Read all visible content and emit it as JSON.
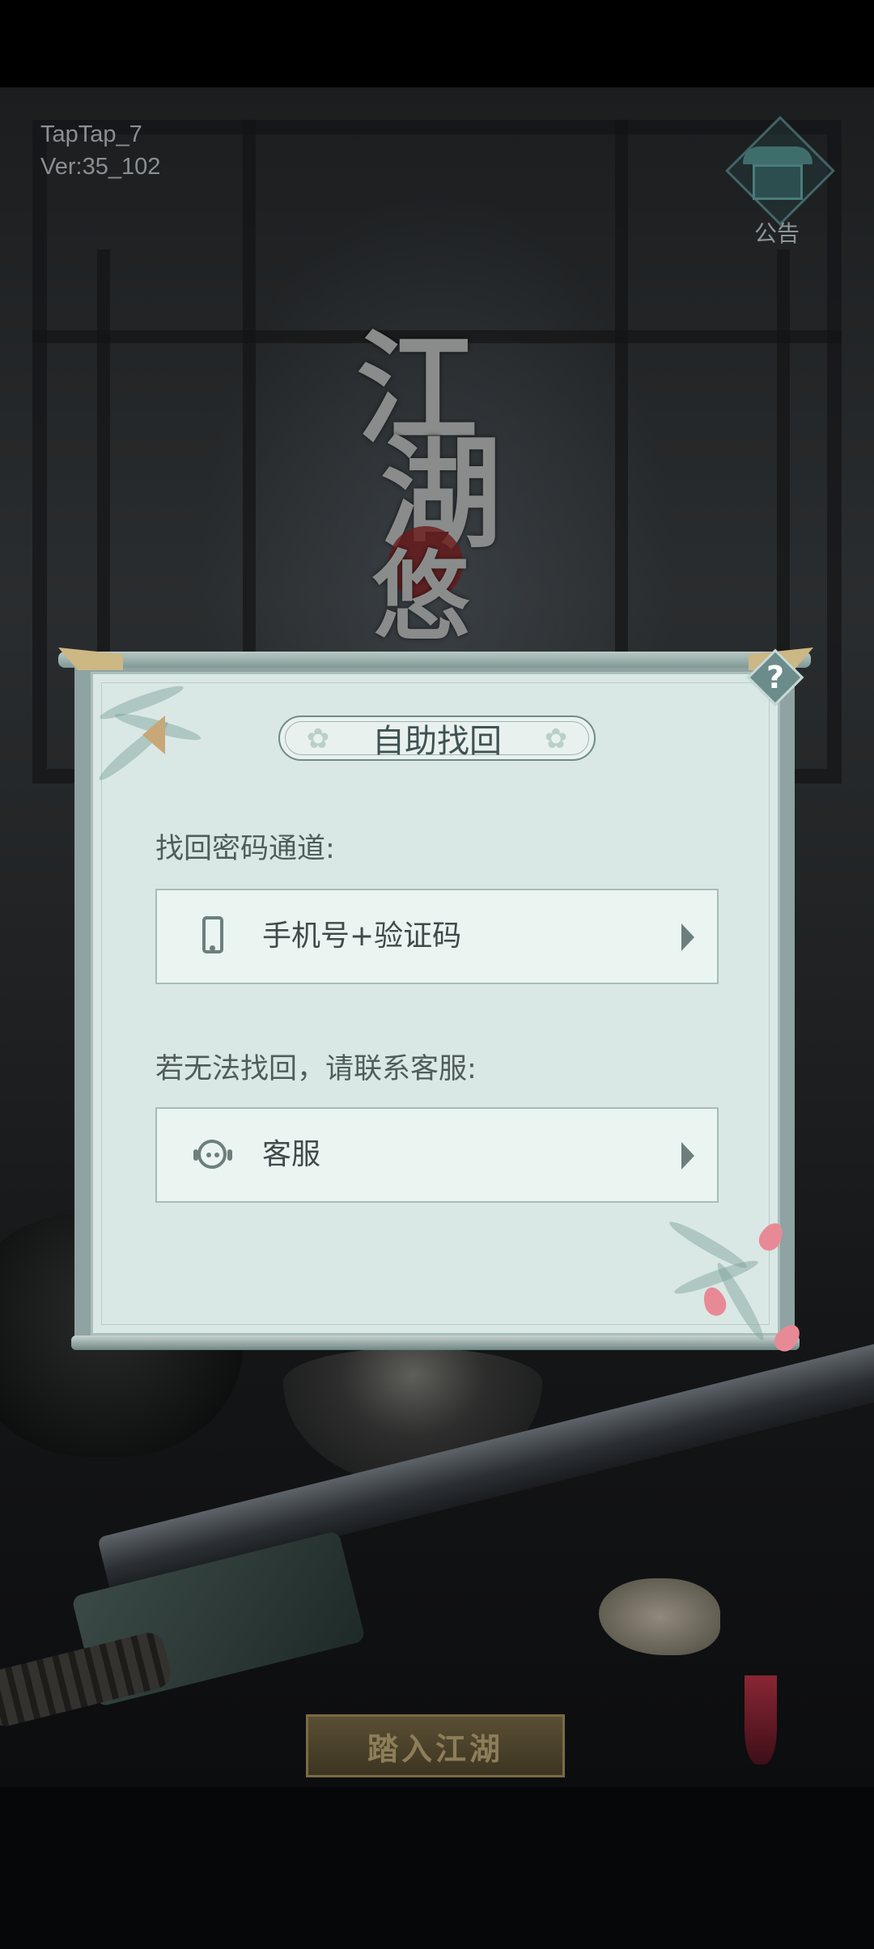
{
  "status": {
    "channel": "TapTap_7",
    "version": "Ver:35_102"
  },
  "notice": {
    "label": "公告"
  },
  "logo": {
    "chars": [
      "江",
      "湖",
      "悠"
    ]
  },
  "dialog": {
    "title": "自助找回",
    "help_symbol": "?",
    "section1_label": "找回密码通道:",
    "option1_label": "手机号+验证码",
    "section2_label": "若无法找回，请联系客服:",
    "option2_label": "客服"
  },
  "enter_button": {
    "label": "踏入江湖"
  },
  "icons": {
    "notice": "pavilion-icon",
    "help": "question-icon",
    "back": "back-arrow-icon",
    "phone": "phone-icon",
    "service": "customer-service-icon",
    "arrow": "chevron-right-icon"
  },
  "colors": {
    "dialog_bg": "#dae8e5",
    "row_bg": "#eaf4f1",
    "accent_gold": "#c8a878",
    "text": "#3f4b4a"
  }
}
